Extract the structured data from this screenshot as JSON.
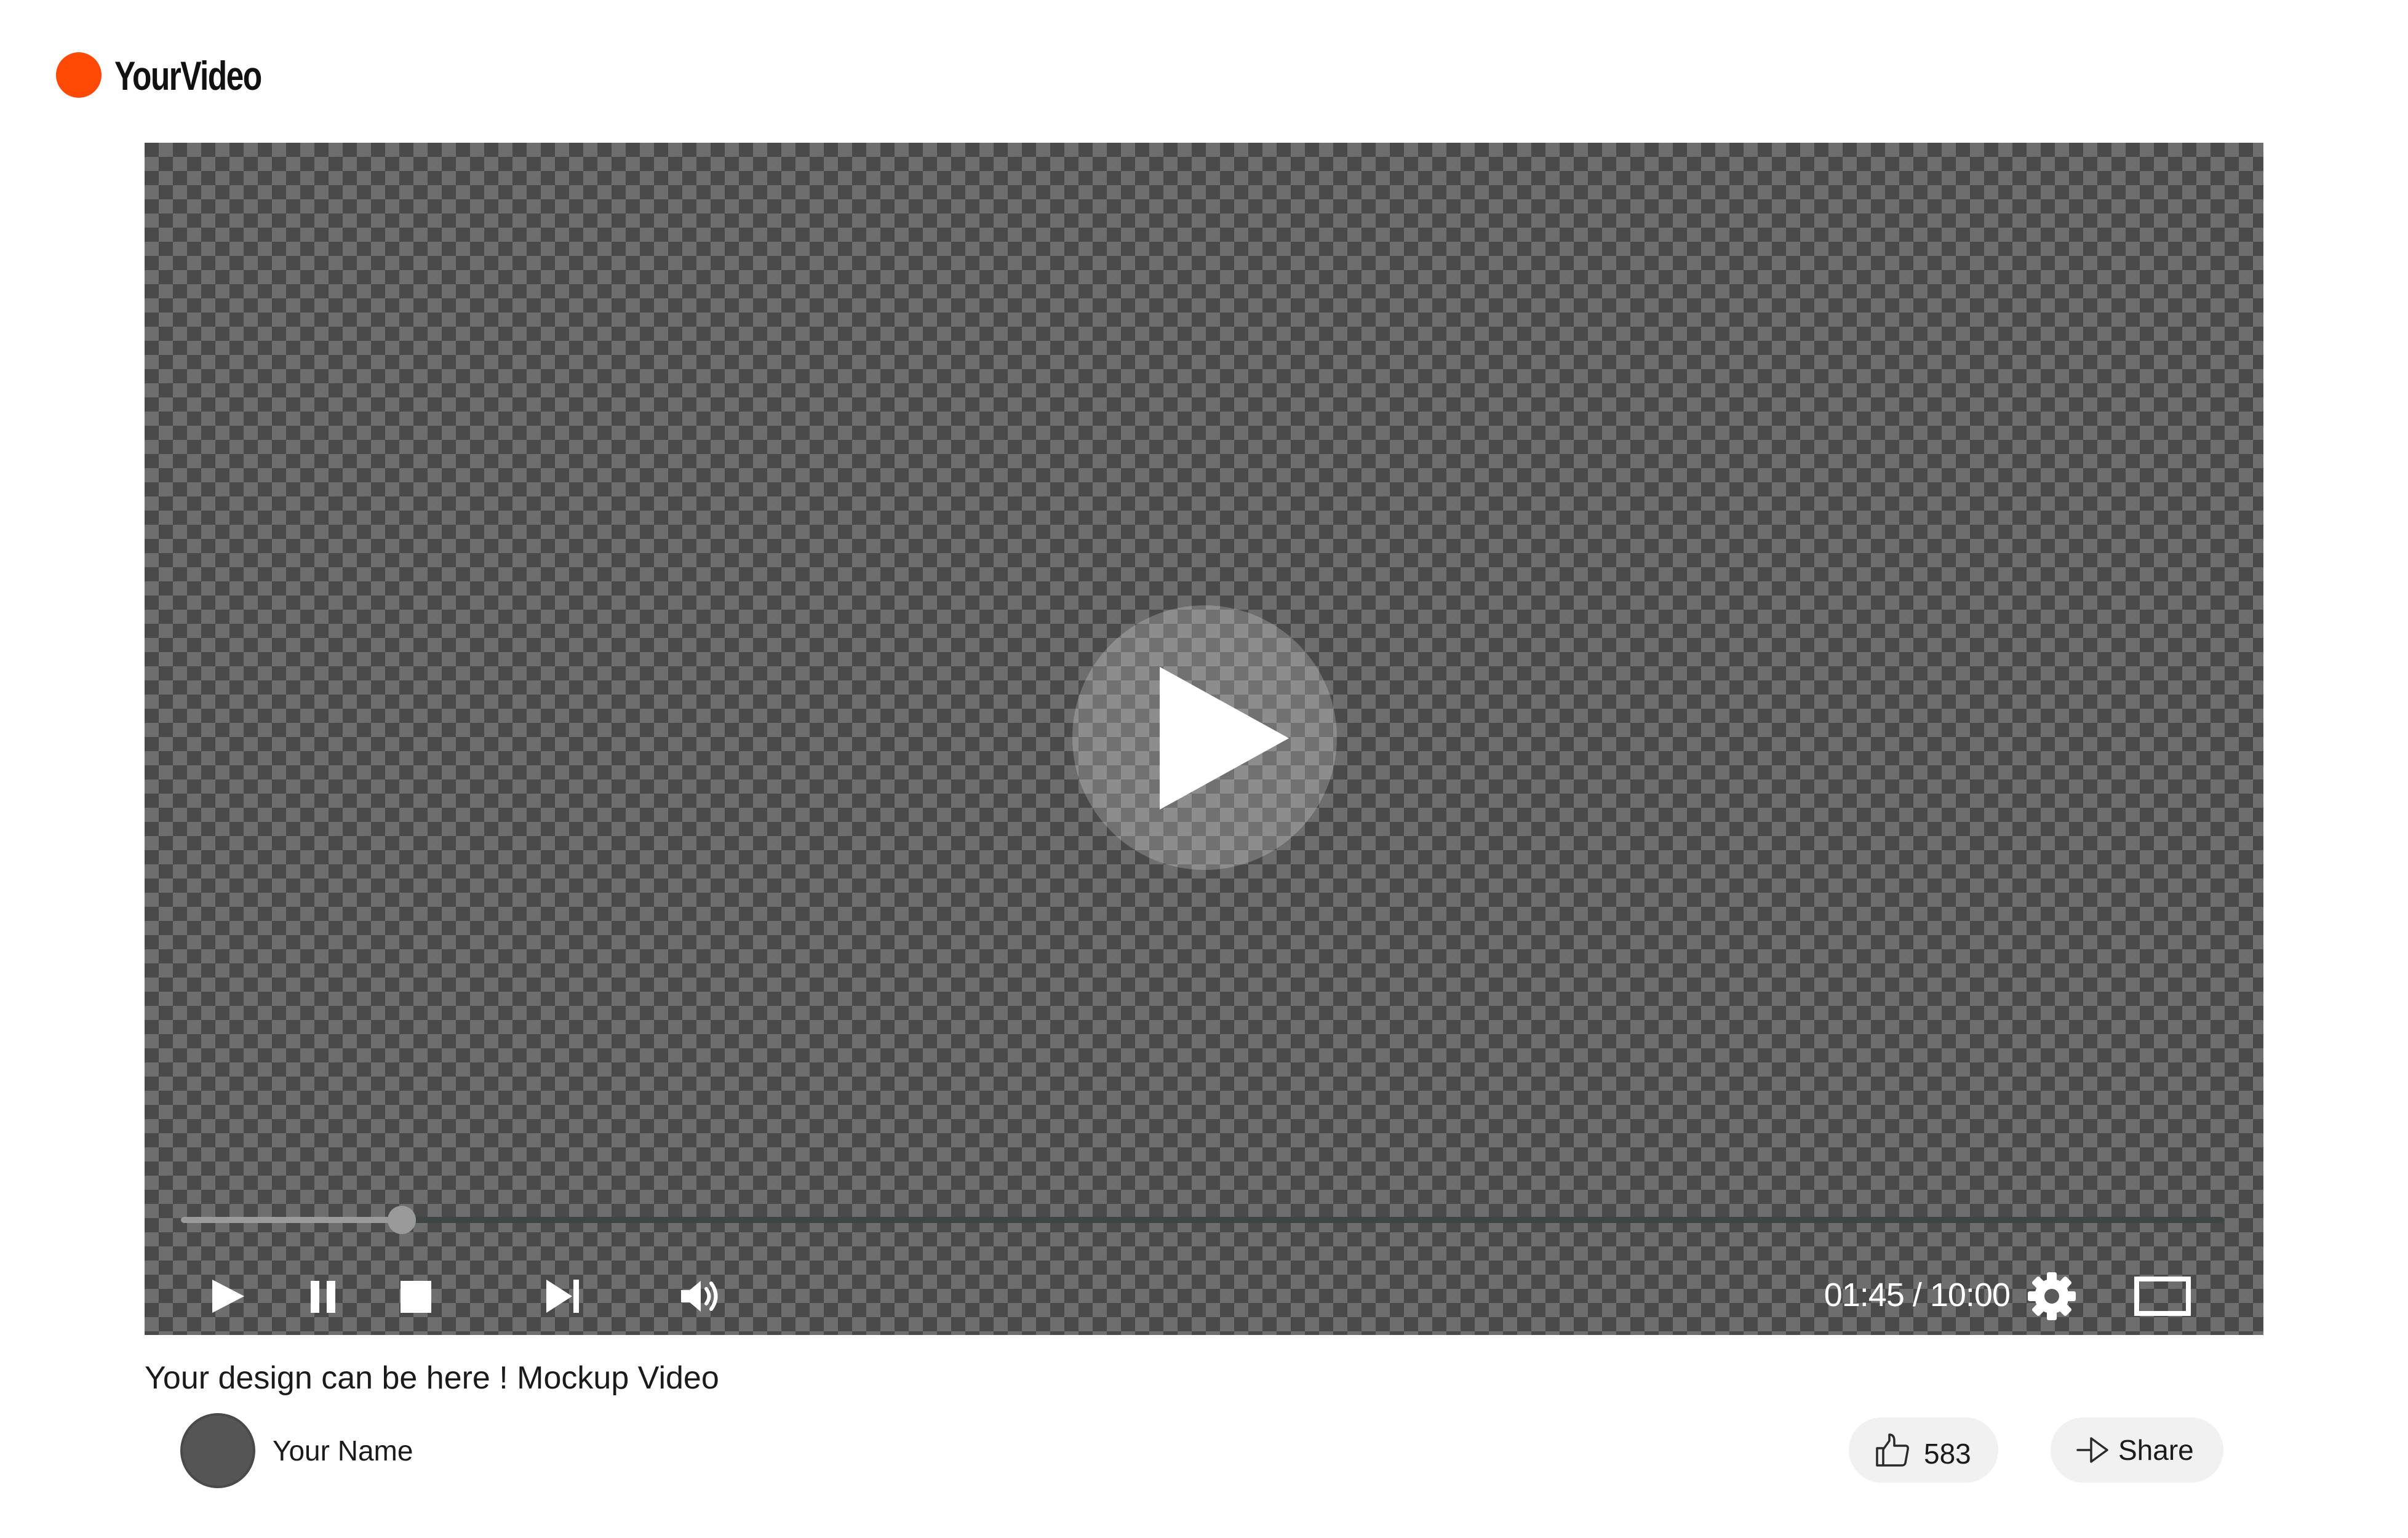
{
  "brand": {
    "name": "YourVideo",
    "logo_icon": "orange-circle-logo",
    "accent_color": "#ff4a07"
  },
  "player": {
    "center_icon": "play-icon",
    "progress_fraction": 0.108,
    "controls": {
      "play_icon": "play-icon",
      "pause_icon": "pause-icon",
      "stop_icon": "stop-icon",
      "next_icon": "skip-next-icon",
      "volume_icon": "volume-icon",
      "settings_icon": "gear-icon",
      "fullscreen_icon": "fullscreen-icon"
    },
    "time_display": "01:45 / 10:00"
  },
  "video": {
    "title": "Your design can be here ! Mockup Video",
    "channel_name": "Your Name"
  },
  "actions": {
    "like_icon": "thumbs-up-icon",
    "like_count": "583",
    "share_icon": "share-arrow-icon",
    "share_label": "Share"
  }
}
